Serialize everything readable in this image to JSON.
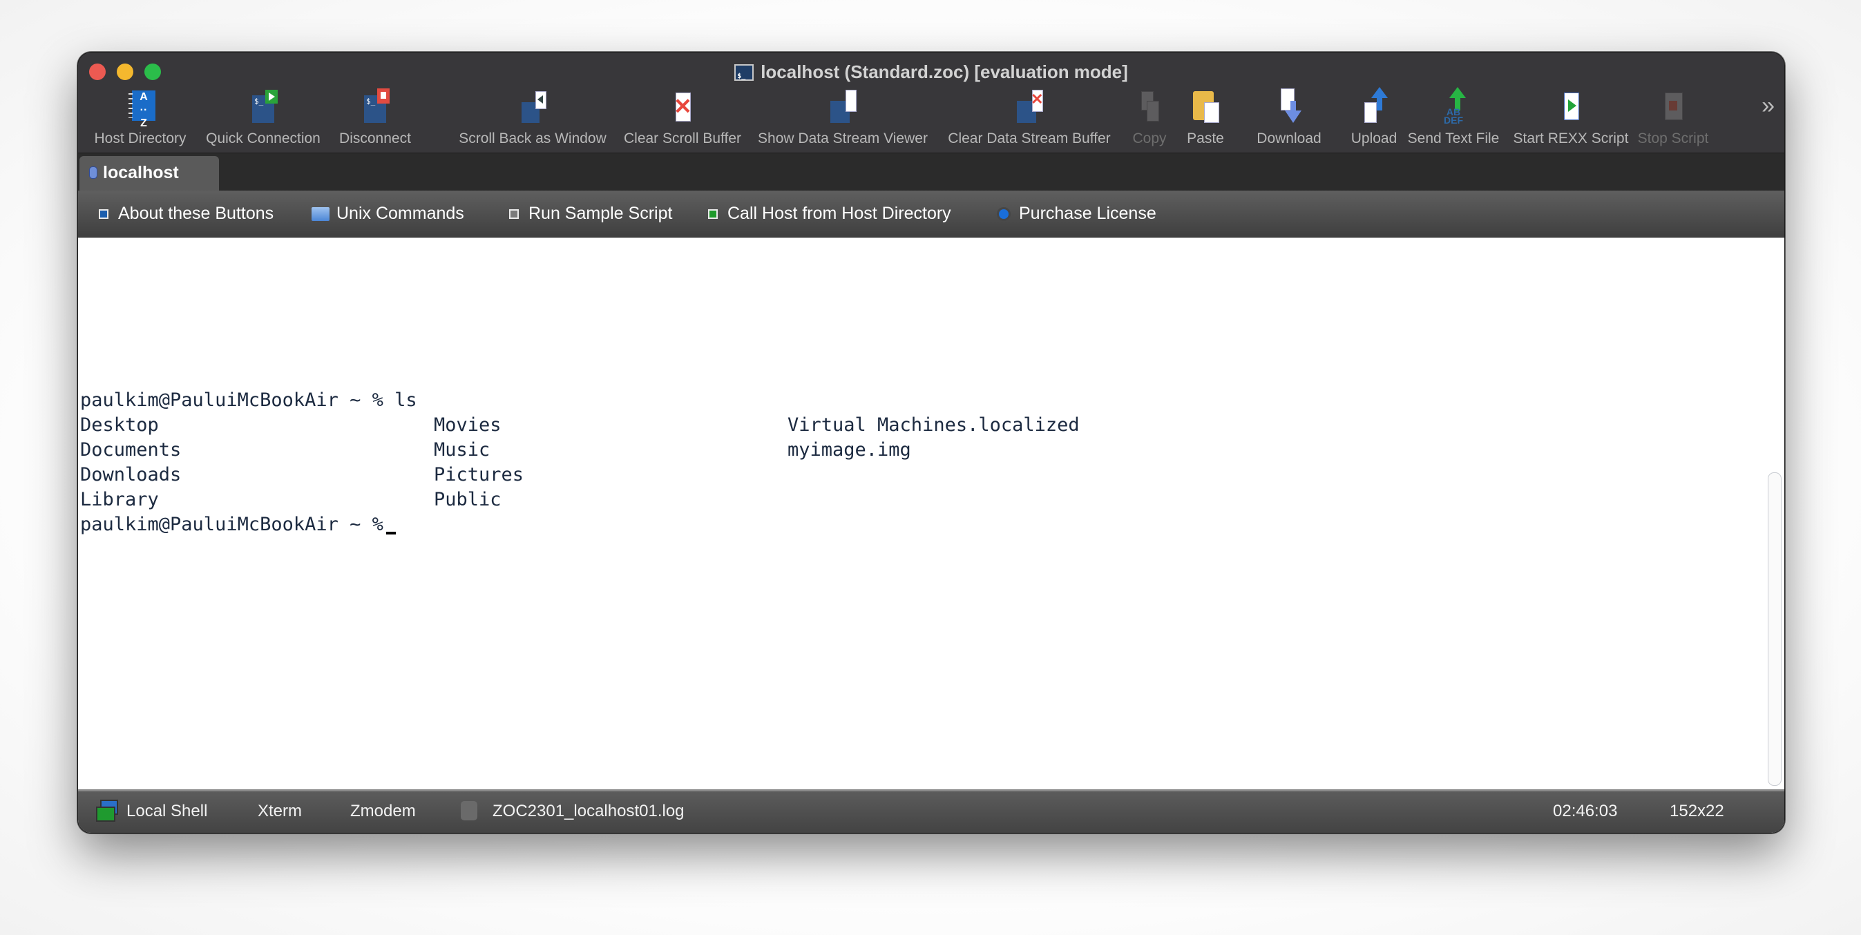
{
  "window": {
    "title": "localhost (Standard.zoc)  [evaluation mode]",
    "title_icon": "terminal-icon"
  },
  "toolbar": {
    "items": [
      {
        "label": "Host Directory",
        "icon": "address-book-icon",
        "enabled": true
      },
      {
        "label": "Quick Connection",
        "icon": "quick-connect-icon",
        "enabled": true
      },
      {
        "label": "Disconnect",
        "icon": "disconnect-icon",
        "enabled": true
      },
      {
        "label": "Scroll Back as Window",
        "icon": "scrollback-icon",
        "enabled": true
      },
      {
        "label": "Clear Scroll Buffer",
        "icon": "clear-scroll-icon",
        "enabled": true
      },
      {
        "label": "Show Data Stream Viewer",
        "icon": "data-stream-icon",
        "enabled": true
      },
      {
        "label": "Clear Data Stream Buffer",
        "icon": "clear-data-stream-icon",
        "enabled": true
      },
      {
        "label": "Copy",
        "icon": "copy-icon",
        "enabled": false
      },
      {
        "label": "Paste",
        "icon": "paste-icon",
        "enabled": true
      },
      {
        "label": "Download",
        "icon": "download-icon",
        "enabled": true
      },
      {
        "label": "Upload",
        "icon": "upload-icon",
        "enabled": true
      },
      {
        "label": "Send Text File",
        "icon": "send-text-icon",
        "enabled": true
      },
      {
        "label": "Start REXX Script",
        "icon": "start-script-icon",
        "enabled": true
      },
      {
        "label": "Stop Script",
        "icon": "stop-script-icon",
        "enabled": false
      }
    ],
    "overflow": "»"
  },
  "tabs": [
    {
      "label": "localhost",
      "active": true
    }
  ],
  "user_buttons": [
    {
      "label": "About these Buttons",
      "icon": "blue-square-icon"
    },
    {
      "label": "Unix Commands",
      "icon": "folder-icon"
    },
    {
      "label": "Run Sample Script",
      "icon": "gray-square-icon"
    },
    {
      "label": "Call Host from Host Directory",
      "icon": "green-square-icon"
    },
    {
      "label": "Purchase License",
      "icon": "blue-circle-icon"
    }
  ],
  "terminal": {
    "prompt": "paulkim@PauluiMcBookAir ~ %",
    "command": "ls",
    "listing": [
      [
        "Desktop",
        "Movies",
        "Virtual Machines.localized"
      ],
      [
        "Documents",
        "Music",
        "myimage.img"
      ],
      [
        "Downloads",
        "Pictures",
        ""
      ],
      [
        "Library",
        "Public",
        ""
      ]
    ],
    "final_prompt": "paulkim@PauluiMcBookAir ~ %"
  },
  "statusbar": {
    "connection_type": "Local Shell",
    "emulation": "Xterm",
    "transfer_protocol": "Zmodem",
    "log_file": "ZOC2301_localhost01.log",
    "time": "02:46:03",
    "dimensions": "152x22"
  }
}
